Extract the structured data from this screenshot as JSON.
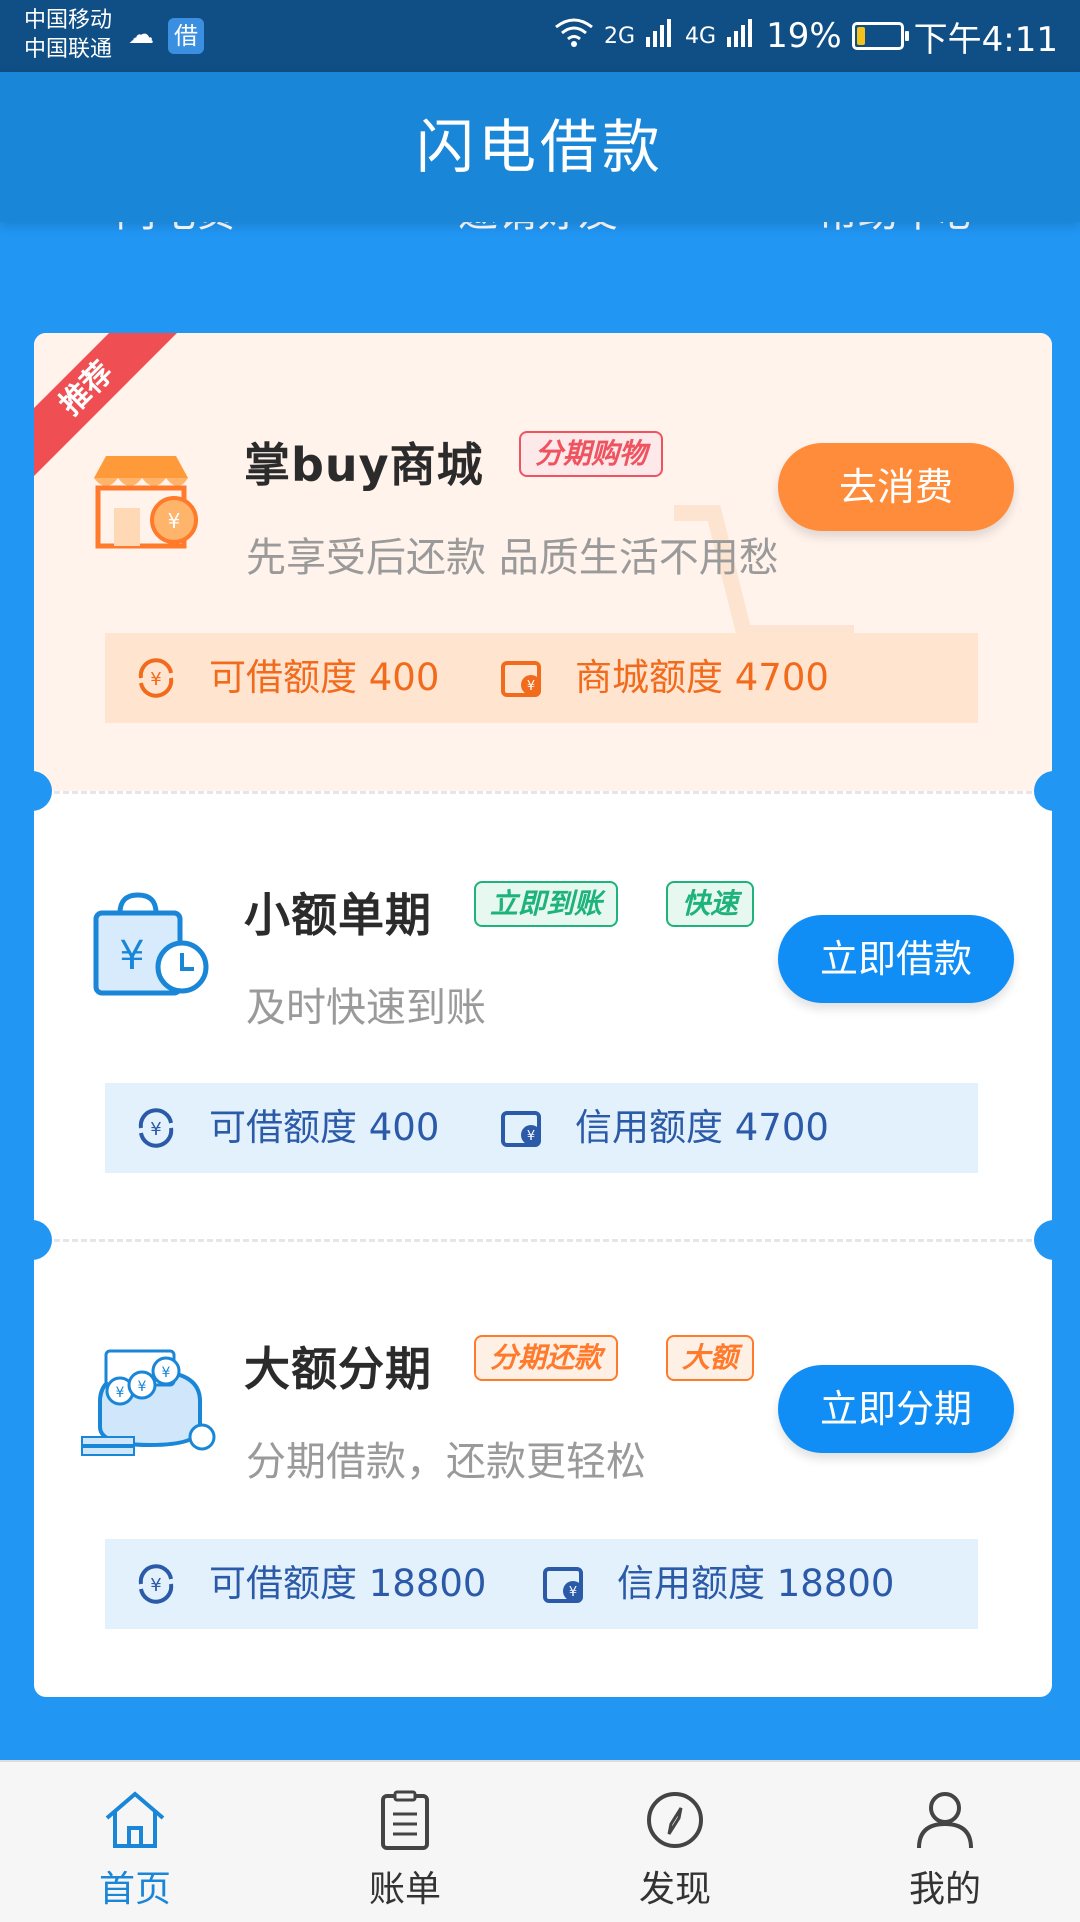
{
  "status_bar": {
    "carrier_1": "中国移动",
    "carrier_2": "中国联通",
    "app_badge": "借",
    "net_1": "2G",
    "net_2": "4G",
    "battery_percent": "19%",
    "battery_level": 0.19,
    "time": "下午4:11"
  },
  "header": {
    "title": "闪电借款"
  },
  "subnav": {
    "items": [
      "闪电贷",
      "邀请好友",
      "帮助中心"
    ]
  },
  "products": [
    {
      "badge": "推荐",
      "title": "掌buy商城",
      "tags": [
        "分期购物"
      ],
      "desc": "先享受后还款 品质生活不用愁",
      "button": "去消费",
      "quota_1": "可借额度 400",
      "quota_2": "商城额度 4700"
    },
    {
      "title": "小额单期",
      "tags": [
        "立即到账",
        "快速"
      ],
      "desc": "及时快速到账",
      "button": "立即借款",
      "quota_1": "可借额度 400",
      "quota_2": "信用额度 4700"
    },
    {
      "title": "大额分期",
      "tags": [
        "分期还款",
        "大额"
      ],
      "desc": "分期借款，还款更轻松",
      "button": "立即分期",
      "quota_1": "可借额度 18800",
      "quota_2": "信用额度 18800"
    }
  ],
  "tabbar": {
    "items": [
      {
        "label": "首页",
        "icon": "home-icon",
        "active": true
      },
      {
        "label": "账单",
        "icon": "bill-icon",
        "active": false
      },
      {
        "label": "发现",
        "icon": "compass-icon",
        "active": false
      },
      {
        "label": "我的",
        "icon": "user-icon",
        "active": false
      }
    ]
  },
  "colors": {
    "primary": "#1a86d8",
    "orange": "#ff8c3a",
    "accent_blue": "#118ef5",
    "tag_red": "#ef5360",
    "tag_green": "#1db37a"
  }
}
